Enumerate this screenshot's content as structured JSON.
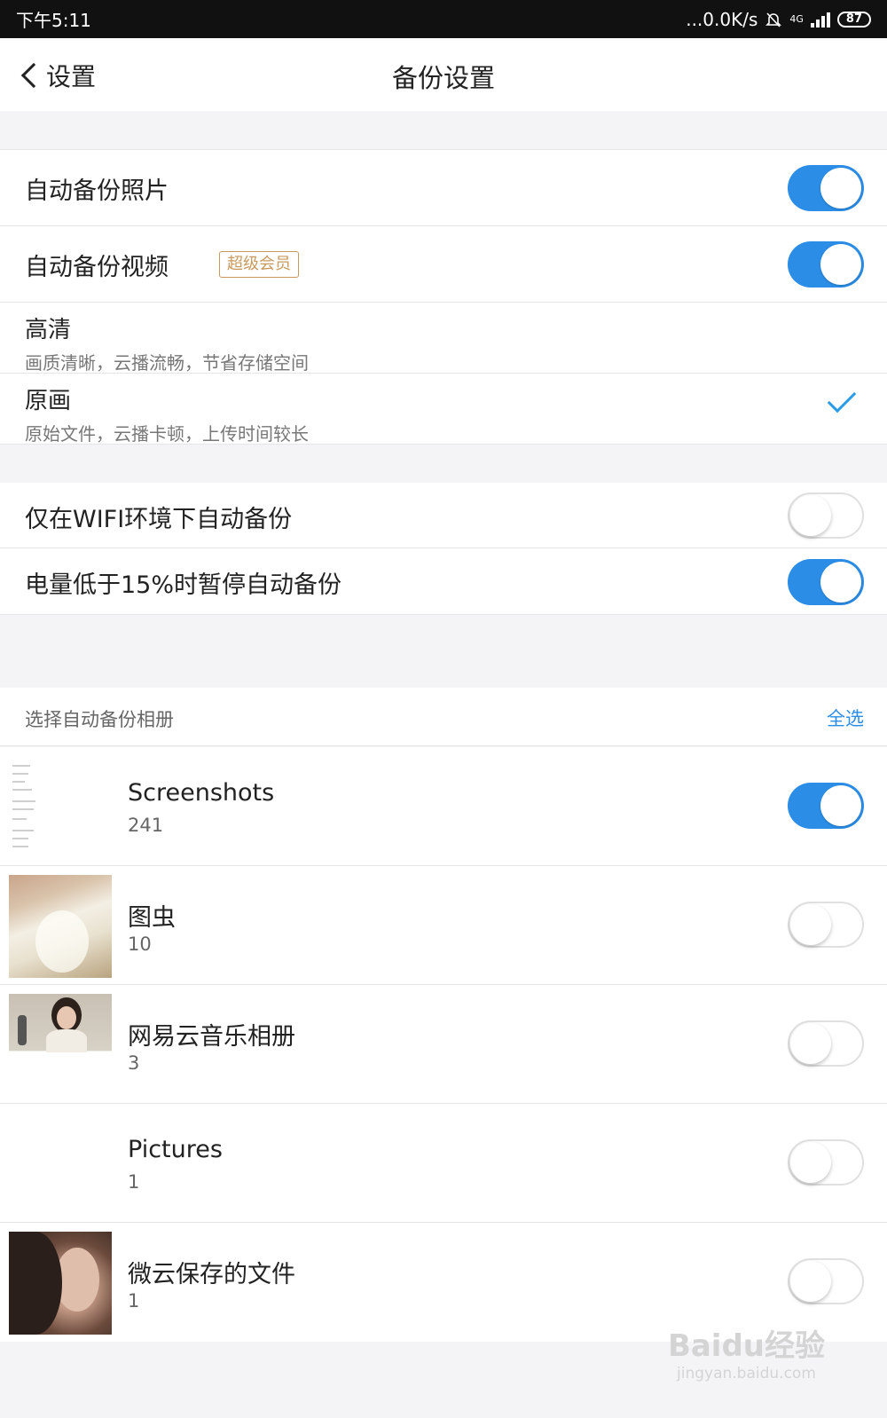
{
  "status_bar": {
    "time": "下午5:11",
    "net_speed": "...0.0K/s",
    "network": "4G",
    "battery": "87"
  },
  "nav": {
    "back_label": "设置",
    "title": "备份设置"
  },
  "backup_photos": {
    "label": "自动备份照片",
    "enabled": true
  },
  "backup_videos": {
    "label": "自动备份视频",
    "badge": "超级会员",
    "enabled": true
  },
  "quality_options": [
    {
      "title": "高清",
      "desc": "画质清晰，云播流畅，节省存储空间",
      "selected": false
    },
    {
      "title": "原画",
      "desc": "原始文件，云播卡顿，上传时间较长",
      "selected": true
    }
  ],
  "wifi_only": {
    "label": "仅在WIFI环境下自动备份",
    "enabled": false
  },
  "low_battery": {
    "label": "电量低于15%时暂停自动备份",
    "enabled": true
  },
  "albums_section": {
    "label": "选择自动备份相册",
    "select_all": "全选"
  },
  "albums": [
    {
      "name": "Screenshots",
      "count": "241",
      "enabled": true
    },
    {
      "name": "图虫",
      "count": "10",
      "enabled": false
    },
    {
      "name": "网易云音乐相册",
      "count": "3",
      "enabled": false
    },
    {
      "name": "Pictures",
      "count": "1",
      "enabled": false
    },
    {
      "name": "微云保存的文件",
      "count": "1",
      "enabled": false
    }
  ],
  "watermark": {
    "main": "Baidu经验",
    "sub": "jingyan.baidu.com"
  },
  "colors": {
    "accent": "#2b8de6",
    "badge": "#c89a5d",
    "status_bar_bg": "#111111"
  }
}
